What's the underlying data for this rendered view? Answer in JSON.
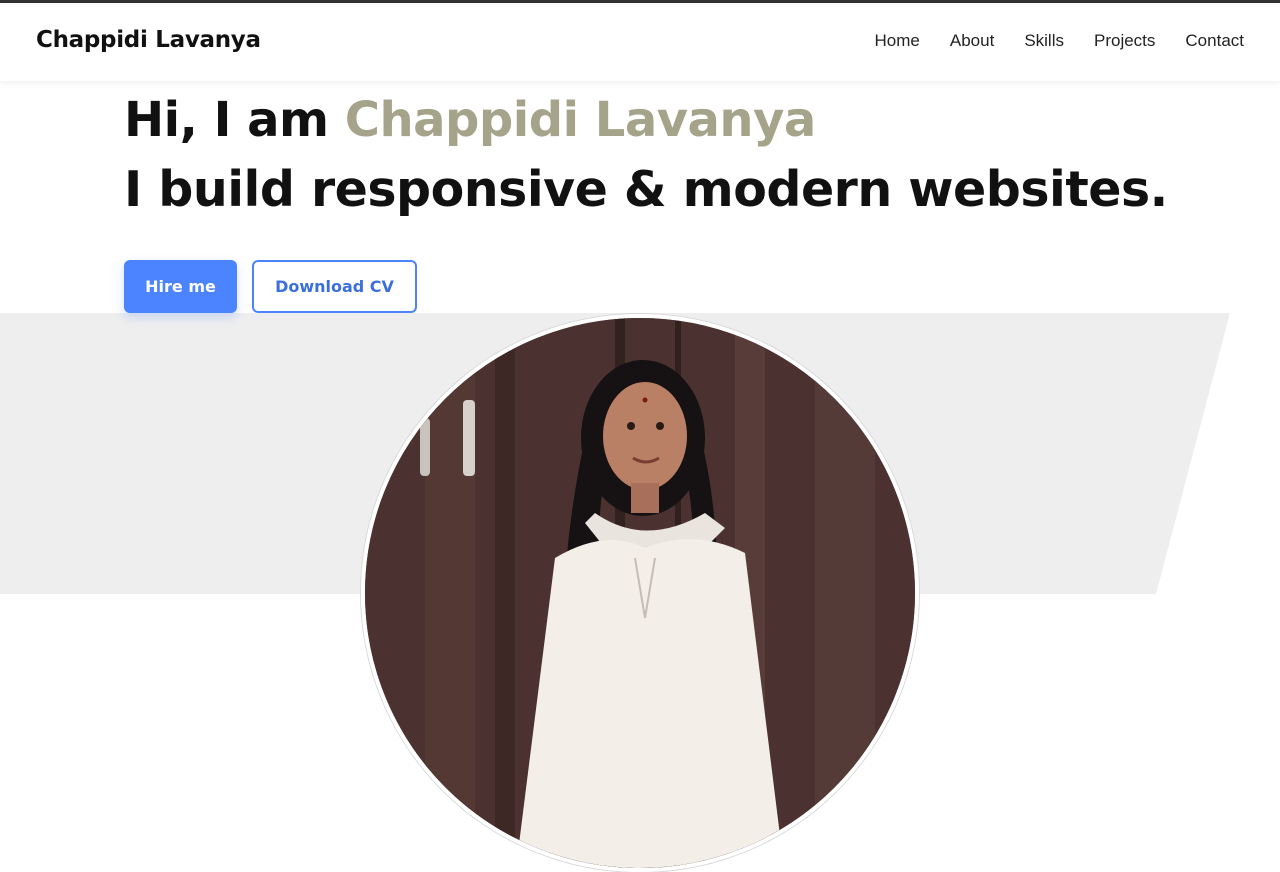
{
  "brand": "Chappidi Lavanya",
  "nav": {
    "items": [
      "Home",
      "About",
      "Skills",
      "Projects",
      "Contact"
    ]
  },
  "hero": {
    "greeting": "Hi, I am ",
    "name": "Chappidi Lavanya",
    "tagline": "I build responsive & modern websites."
  },
  "buttons": {
    "hire": "Hire me",
    "cv": "Download CV"
  },
  "colors": {
    "accent": "#4c84ff",
    "name_color": "#a5a38a",
    "band_gray": "#eeeeee"
  }
}
